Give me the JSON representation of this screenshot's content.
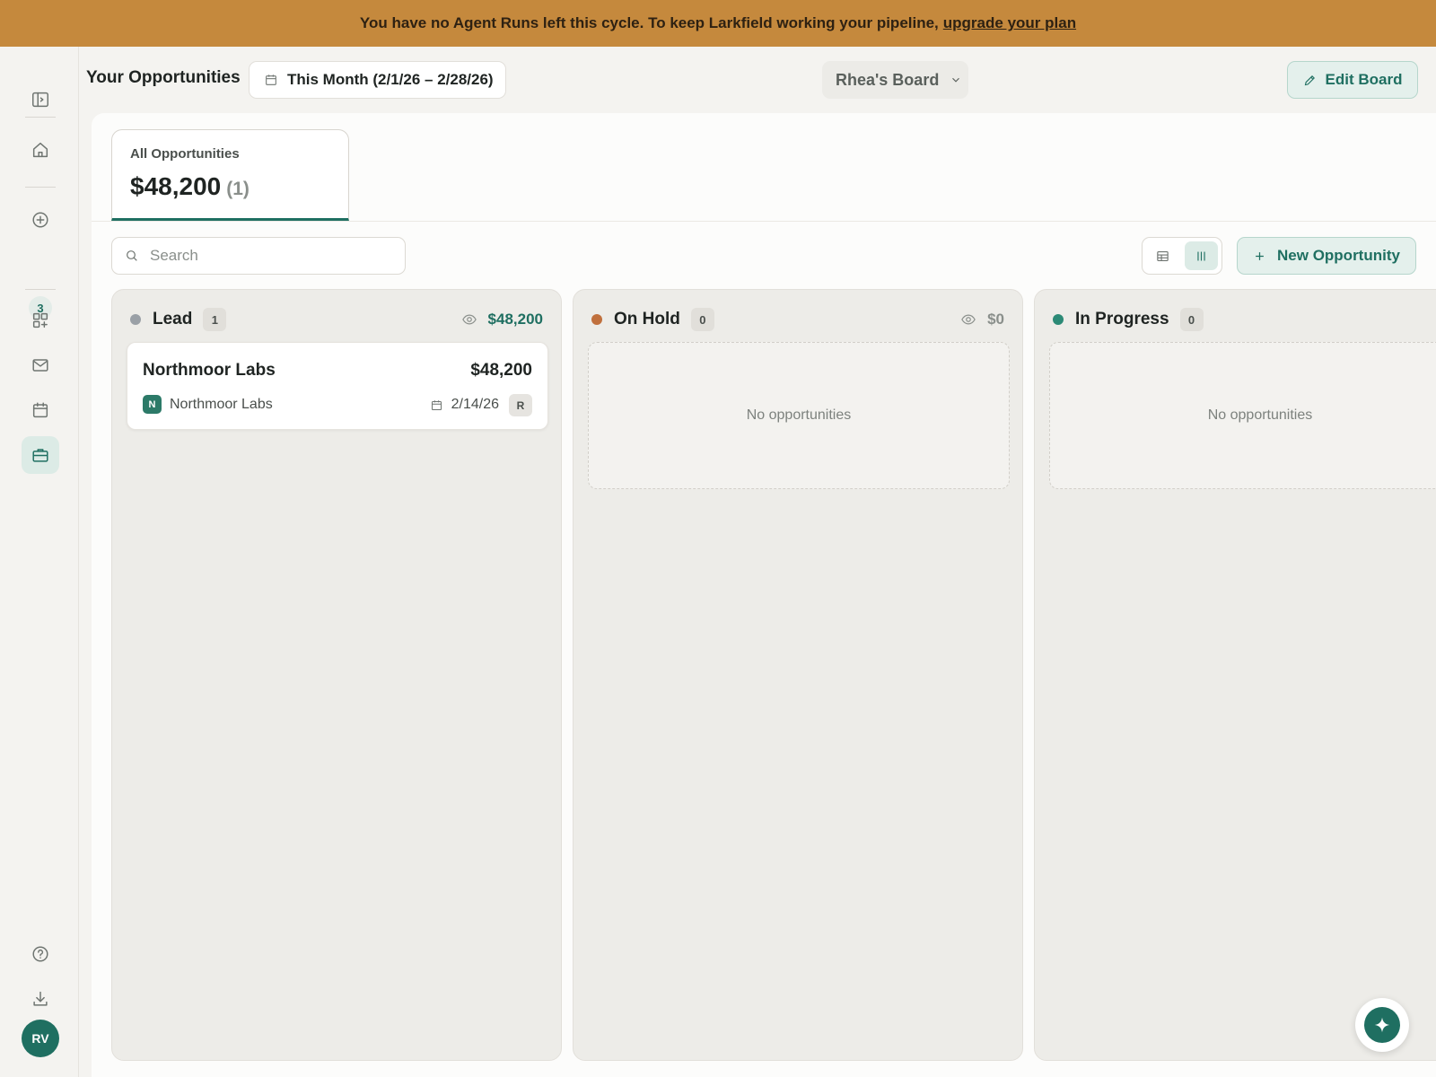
{
  "banner": {
    "text": "You have no Agent Runs left this cycle. To keep Larkfield working your pipeline,",
    "link_label": "upgrade your plan"
  },
  "sidebar": {
    "badge_count": "3",
    "avatar_initials": "RV",
    "items": [
      {
        "icon": "sidebar-toggle-icon"
      },
      {
        "icon": "home-icon"
      },
      {
        "icon": "plus-circle-icon"
      },
      {
        "icon": "apps-icon"
      },
      {
        "icon": "mail-icon"
      },
      {
        "icon": "calendar-icon"
      },
      {
        "icon": "briefcase-icon",
        "active": true
      },
      {
        "icon": "help-icon"
      },
      {
        "icon": "download-icon"
      }
    ]
  },
  "header": {
    "title": "Your Opportunities",
    "date_range": "This Month (2/1/26 – 2/28/26)",
    "board_name": "Rhea's Board",
    "edit_label": "Edit Board"
  },
  "summary": {
    "label": "All Opportunities",
    "value": "$48,200",
    "count": "(1)"
  },
  "toolbar": {
    "search_placeholder": "Search",
    "new_label": "New Opportunity"
  },
  "columns": [
    {
      "name": "Lead",
      "count": "1",
      "total": "$48,200",
      "dot_color": "#9aa0a6",
      "total_color": "#1f6f61",
      "cards": [
        {
          "title": "Northmoor Labs",
          "amount": "$48,200",
          "company_initial": "N",
          "company": "Northmoor Labs",
          "date": "2/14/26",
          "owner": "R"
        }
      ]
    },
    {
      "name": "On Hold",
      "count": "0",
      "total": "$0",
      "dot_color": "#c0703d",
      "total_color": "#8a8f8b",
      "empty_text": "No opportunities"
    },
    {
      "name": "In Progress",
      "count": "0",
      "dot_color": "#2c8a76",
      "empty_text": "No opportunities"
    }
  ],
  "colors": {
    "accent": "#1f6f61",
    "banner": "#c5893d"
  }
}
